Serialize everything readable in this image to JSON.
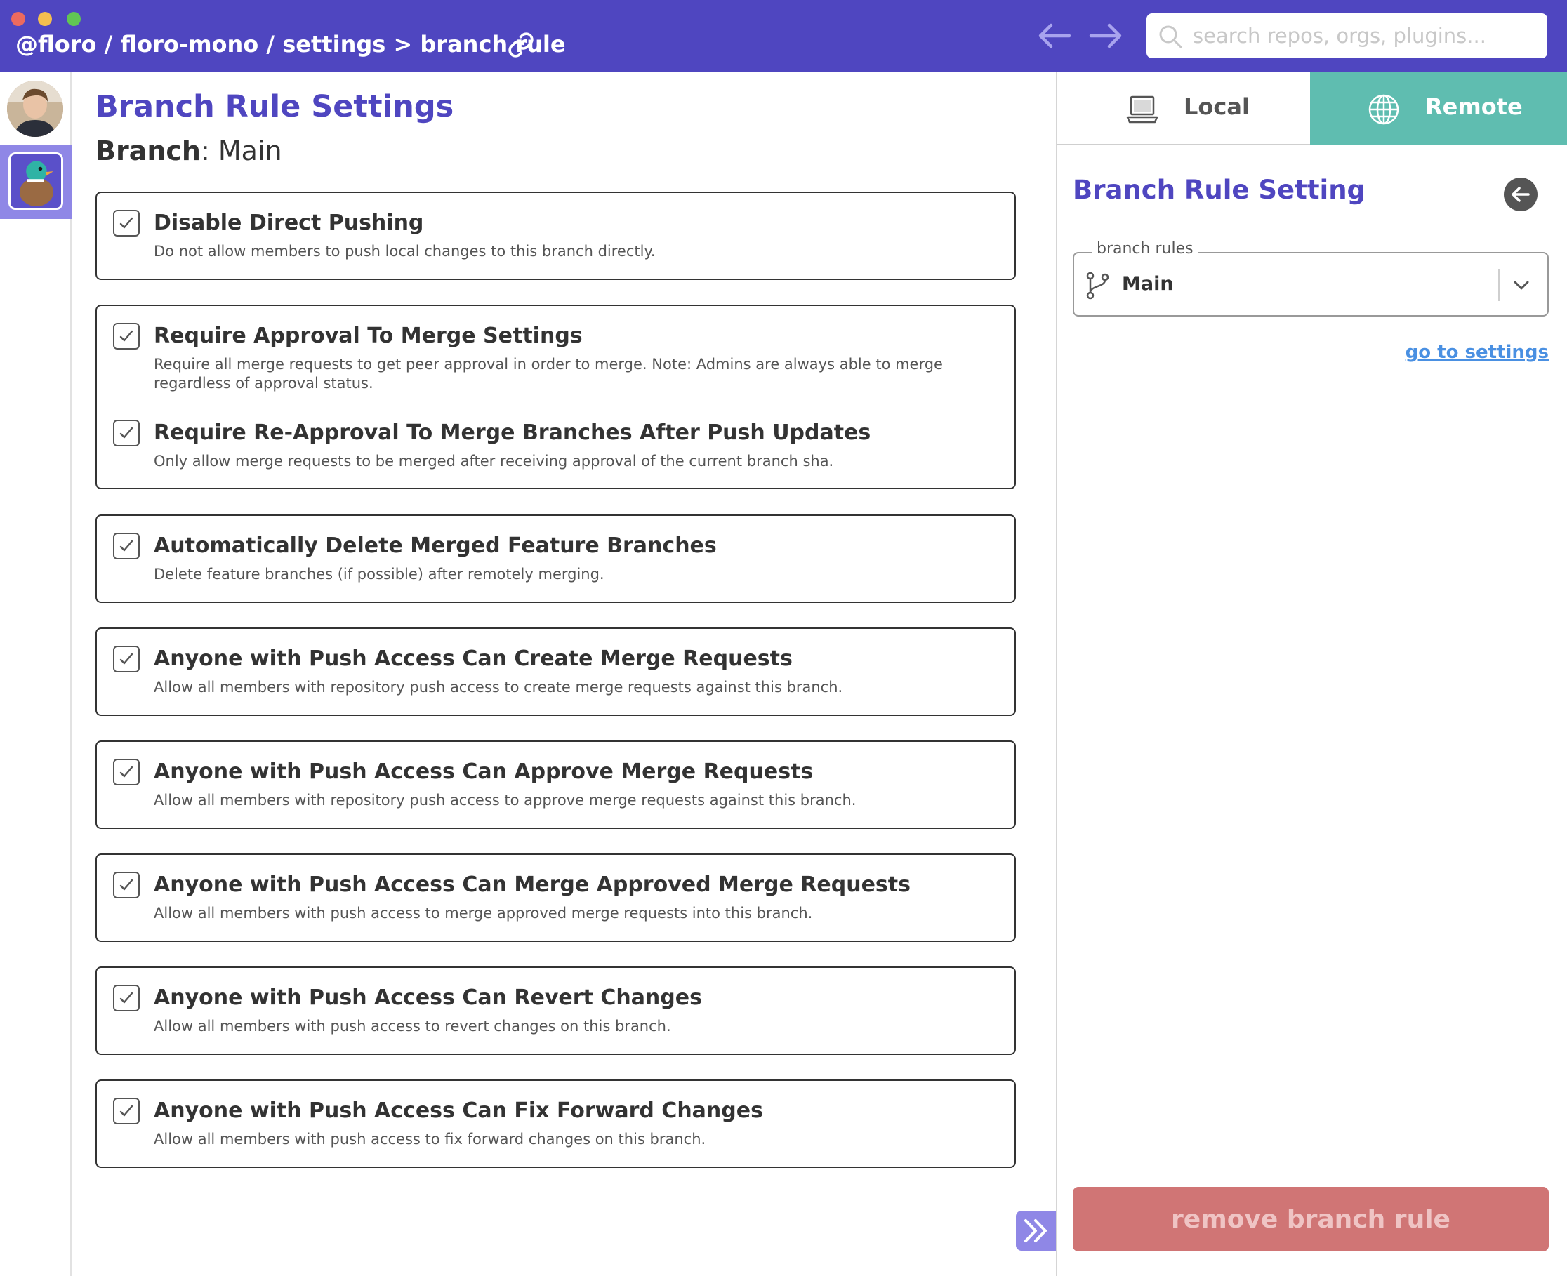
{
  "titlebar": {
    "breadcrumb": "@floro / floro-mono / settings > branch rule",
    "search_placeholder": "search repos, orgs, plugins...",
    "icons": [
      "link-icon",
      "back-arrow-icon",
      "forward-arrow-icon",
      "search-icon"
    ],
    "colors": {
      "bar": "#4f46c0"
    }
  },
  "rail": {
    "icons": [
      "avatar",
      "plugin-duck-icon"
    ]
  },
  "main": {
    "title": "Branch Rule Settings",
    "branch_label": "Branch",
    "branch_value": ": Main",
    "options": [
      {
        "title": "Disable Direct Pushing",
        "desc": "Do not allow members to push local changes to this branch directly.",
        "checked": true
      },
      {
        "title": "Require Approval To Merge Settings",
        "desc": "Require all merge requests to get peer approval in order to merge. Note: Admins are always able to merge regardless of approval status.",
        "checked": true
      },
      {
        "title": "Require Re-Approval To Merge Branches After Push Updates",
        "desc": "Only allow merge requests to be merged after receiving approval of the current branch sha.",
        "checked": true
      },
      {
        "title": "Automatically Delete Merged Feature Branches",
        "desc": "Delete feature branches (if possible) after remotely merging.",
        "checked": true
      },
      {
        "title": "Anyone with Push Access Can Create Merge Requests",
        "desc": "Allow all members with repository push access to create merge requests against this branch.",
        "checked": true
      },
      {
        "title": "Anyone with Push Access Can Approve Merge Requests",
        "desc": "Allow all members with repository push access to approve merge requests against this branch.",
        "checked": true
      },
      {
        "title": "Anyone with Push Access Can Merge Approved Merge Requests",
        "desc": "Allow all members with push access to merge approved merge requests into this branch.",
        "checked": true
      },
      {
        "title": "Anyone with Push Access Can Revert Changes",
        "desc": "Allow all members with push access to revert changes on this branch.",
        "checked": true
      },
      {
        "title": "Anyone with Push Access Can Fix Forward Changes",
        "desc": "Allow all members with push access to fix forward changes on this branch.",
        "checked": true
      }
    ]
  },
  "right_panel": {
    "tabs": [
      {
        "label": "Local",
        "icon": "laptop-icon",
        "active": false
      },
      {
        "label": "Remote",
        "icon": "globe-icon",
        "active": true
      }
    ],
    "title": "Branch Rule Setting",
    "select_legend": "branch rules",
    "select_value": "Main",
    "go_settings": "go to settings",
    "remove_button": "remove branch rule",
    "colors": {
      "remote_tab": "#5fbdb0",
      "remove": "#d07575",
      "link": "#4a90e2",
      "title": "#4f46c0"
    }
  }
}
